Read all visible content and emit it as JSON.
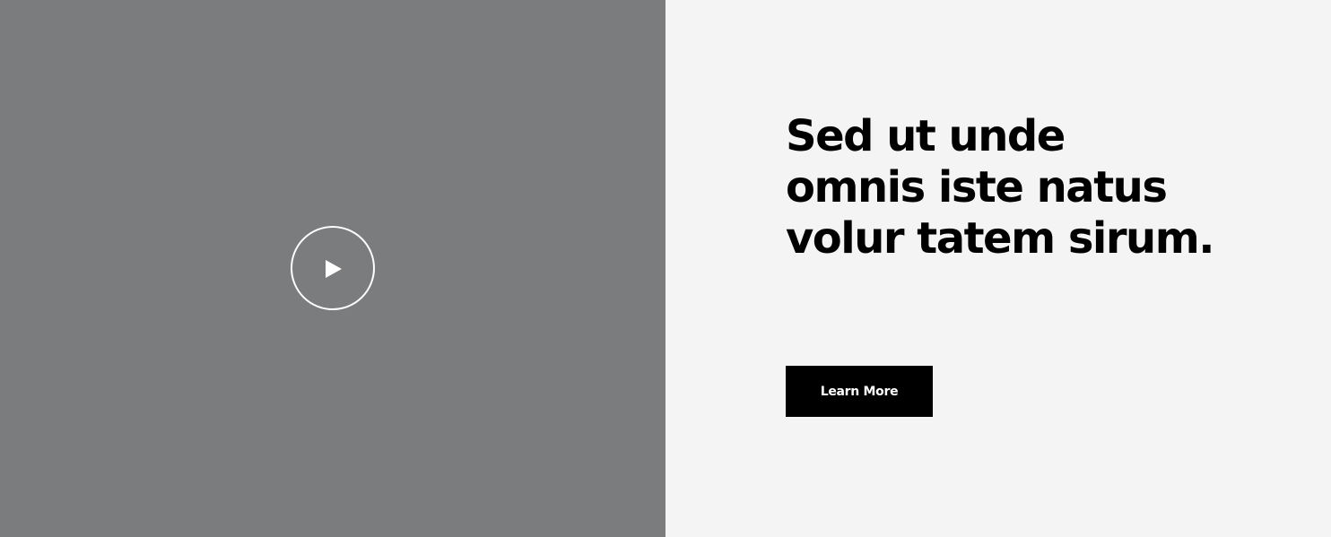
{
  "video": {
    "play_icon": "play-icon",
    "background_color": "#7b7c7e"
  },
  "content": {
    "headline": "Sed ut unde omnis iste natus volur tatem sirum.",
    "cta_label": "Learn More",
    "background_color": "#f4f4f4"
  }
}
